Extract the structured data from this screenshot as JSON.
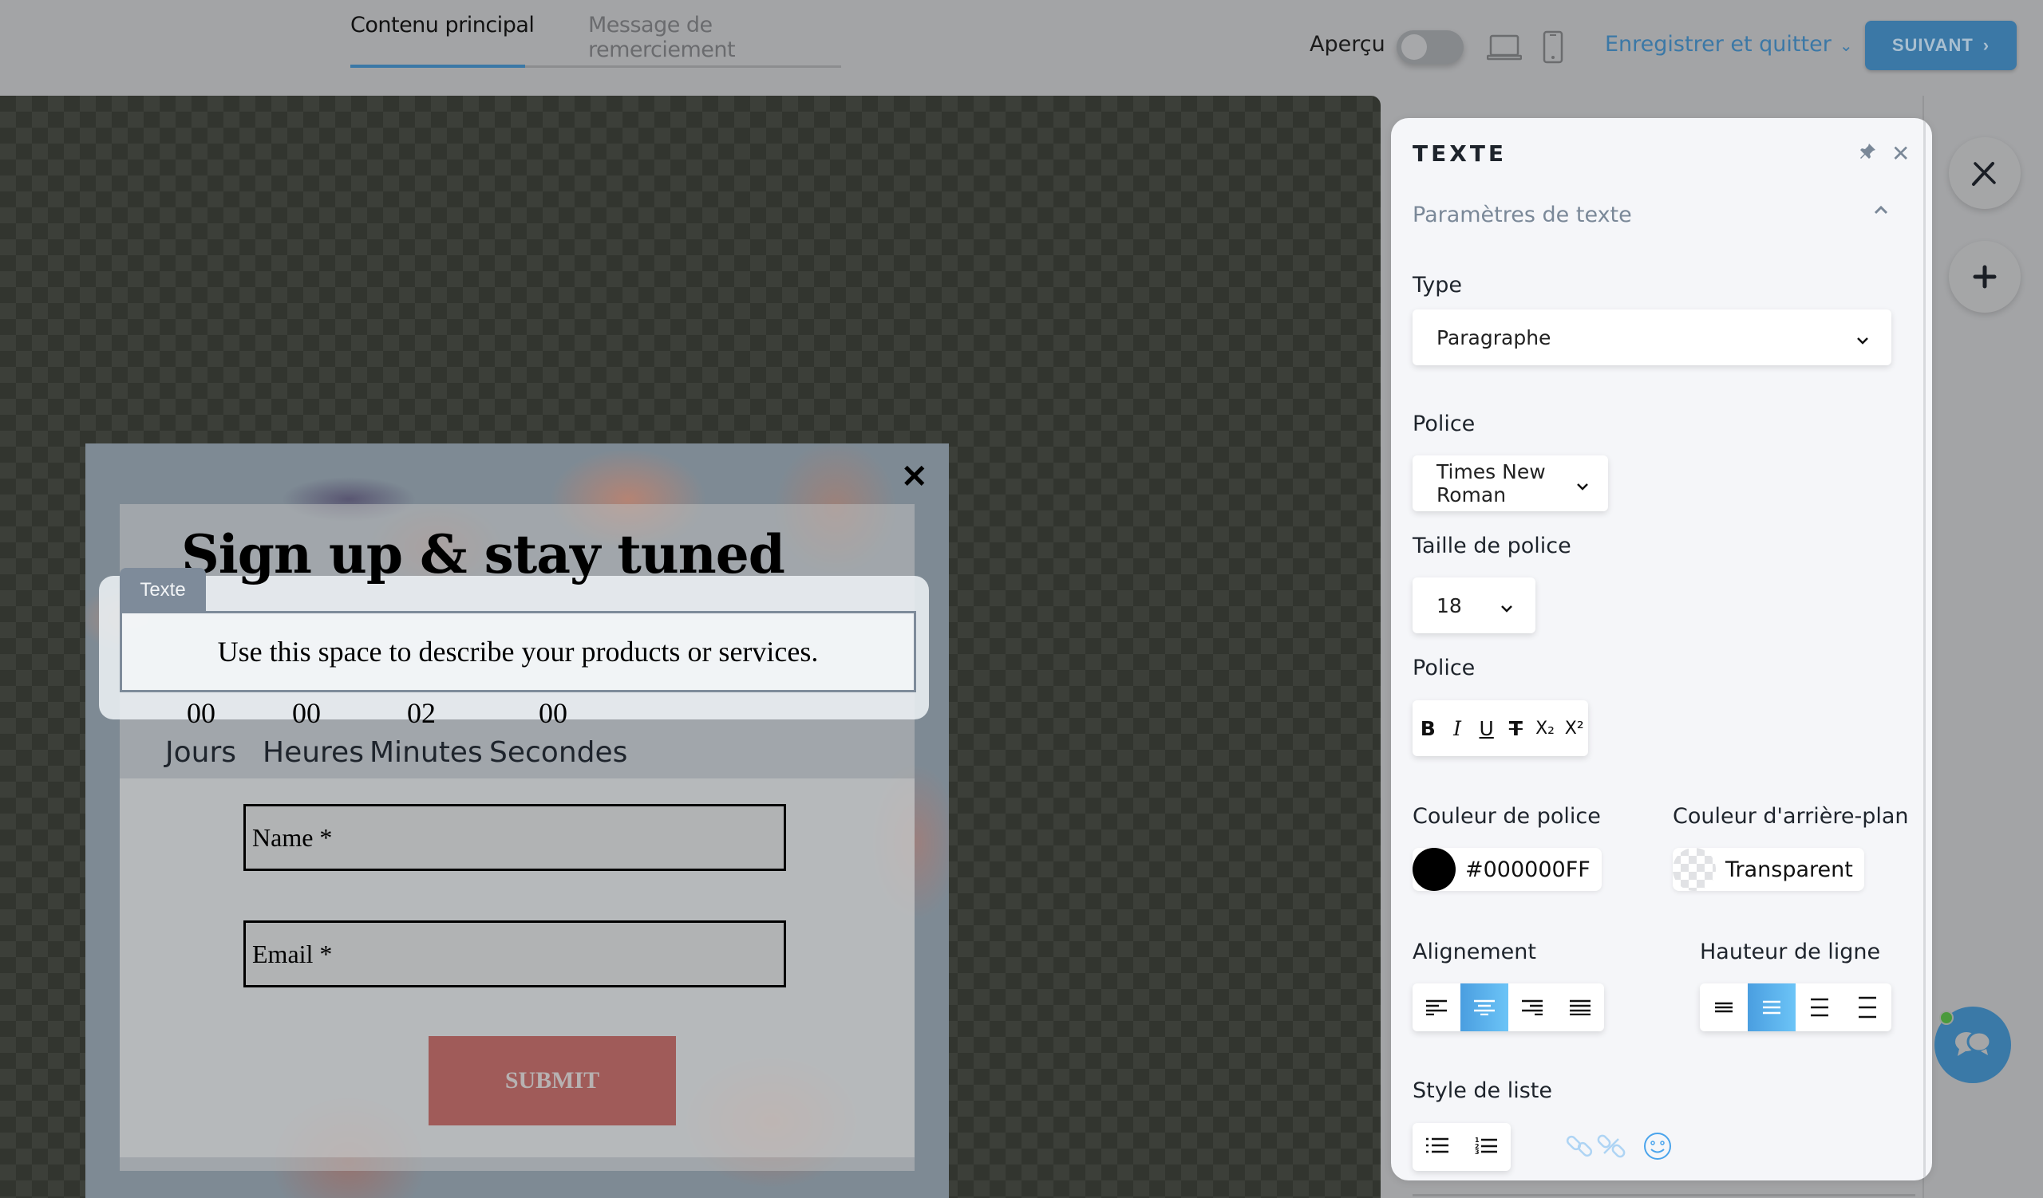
{
  "header": {
    "tabs": [
      {
        "label": "Contenu principal",
        "active": true
      },
      {
        "label": "Message de remerciement",
        "active": false
      }
    ],
    "preview_label": "Aperçu",
    "preview_enabled": false,
    "save_quit_label": "Enregistrer et quitter",
    "next_label": "SUIVANT"
  },
  "popup": {
    "close_glyph": "✕",
    "heading": "Sign up & stay tuned",
    "selection_tag": "Texte",
    "description": "Use this space to describe your products or services.",
    "countdown": [
      {
        "value": "00",
        "label": "Jours"
      },
      {
        "value": "00",
        "label": "Heures"
      },
      {
        "value": "02",
        "label": "Minutes"
      },
      {
        "value": "00",
        "label": "Secondes"
      }
    ],
    "fields": [
      {
        "placeholder": "Name *"
      },
      {
        "placeholder": "Email *"
      }
    ],
    "submit_label": "SUBMIT",
    "submit_color": "#a05b59"
  },
  "panel": {
    "title": "TEXTE",
    "section": "Paramètres de texte",
    "type_label": "Type",
    "type_value": "Paragraphe",
    "font_label": "Police",
    "font_value": "Times New Roman",
    "size_label": "Taille de police",
    "size_value": "18",
    "style_label": "Police",
    "style_buttons": [
      "B",
      "I",
      "U",
      "T",
      "X₂",
      "X²"
    ],
    "font_color_label": "Couleur de police",
    "font_color_value": "#000000FF",
    "bg_color_label": "Couleur d'arrière-plan",
    "bg_color_value": "Transparent",
    "align_label": "Alignement",
    "align_selected": "center",
    "line_height_label": "Hauteur de ligne",
    "line_height_selected": 2,
    "list_label": "Style de liste"
  },
  "colors": {
    "accent": "#3b78a6",
    "active_segment": "#4a9ee0"
  }
}
